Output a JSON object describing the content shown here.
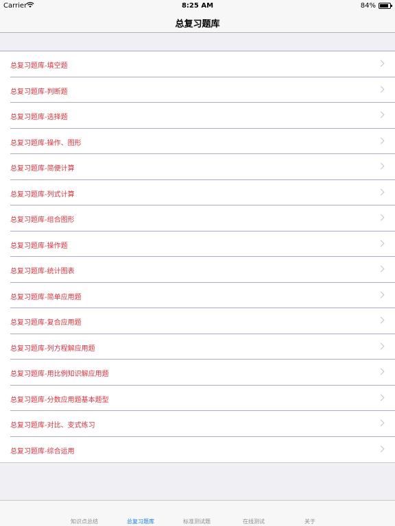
{
  "status_bar": {
    "carrier": "Carrier",
    "time": "8:25 AM",
    "battery": "84%",
    "battery_level": 0.84
  },
  "nav": {
    "title": "总复习题库"
  },
  "list": {
    "items": [
      {
        "label": "总复习题库-填空题"
      },
      {
        "label": "总复习题库-判断题"
      },
      {
        "label": "总复习题库-选择题"
      },
      {
        "label": "总复习题库-操作、图形"
      },
      {
        "label": "总复习题库-简便计算"
      },
      {
        "label": "总复习题库-列式计算"
      },
      {
        "label": "总复习题库-组合图形"
      },
      {
        "label": "总复习题库-操作题"
      },
      {
        "label": "总复习题库-统计图表"
      },
      {
        "label": "总复习题库-简单应用题"
      },
      {
        "label": "总复习题库-复合应用题"
      },
      {
        "label": "总复习题库-列方程解应用题"
      },
      {
        "label": "总复习题库-用比例知识解应用题"
      },
      {
        "label": "总复习题库-分数应用题基本题型"
      },
      {
        "label": "总复习题库-对比、变式练习"
      },
      {
        "label": "总复习题库-综合运用"
      }
    ]
  },
  "tab_bar": {
    "tabs": [
      {
        "label": "知识点总结"
      },
      {
        "label": "总复习题库"
      },
      {
        "label": "标准测试题"
      },
      {
        "label": "在线测试"
      },
      {
        "label": "关于"
      }
    ]
  },
  "colors": {
    "row_text": "#e8303a",
    "separator": "#a7a7ea",
    "active_tab": "#1a7dfa"
  }
}
